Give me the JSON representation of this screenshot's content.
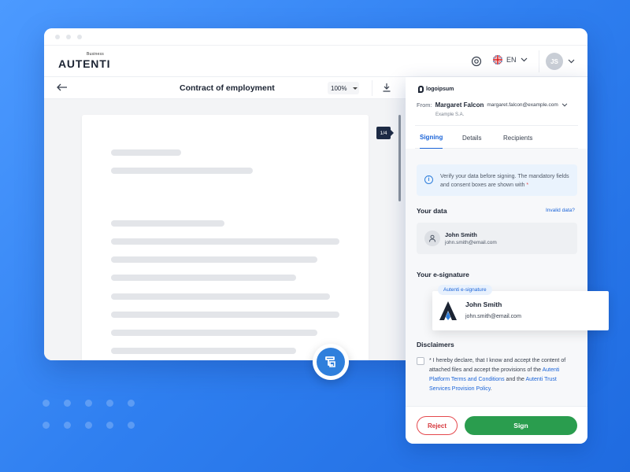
{
  "app": {
    "logo_main": "AUTENTI",
    "logo_sub": "Business",
    "language": "EN",
    "user_initials": "JS"
  },
  "doc_toolbar": {
    "title": "Contract of employment",
    "zoom": "100%"
  },
  "viewer": {
    "page_indicator": "1/4"
  },
  "panel": {
    "logo_text": "logoipsum",
    "from_label": "From:",
    "sender_name": "Margaret Falcon",
    "sender_email": "margaret.falcon@example.com",
    "sender_company": "Example S.A.",
    "tabs": [
      {
        "label": "Signing"
      },
      {
        "label": "Details"
      },
      {
        "label": "Recipients"
      }
    ],
    "info_text": "Verify your data before signing. The mandatory fields and consent boxes are shown with",
    "required_mark": "*",
    "your_data": {
      "title": "Your data",
      "invalid_link": "Invalid data?",
      "name": "John Smith",
      "email": "john.smith@email.com"
    },
    "esignature": {
      "title": "Your e-signature",
      "chip": "Autenti e-signature",
      "name": "John Smith",
      "email": "john.smith@email.com"
    },
    "disclaimers": {
      "title": "Disclaimers",
      "prefix": "* I hereby declare, that I know and accept the content of attached files and accept the provisions of the",
      "link1": "Autenti Platform Terms and Conditions",
      "middle": "and the",
      "link2": "Autenti Trust Services Provision Policy",
      "suffix": "."
    },
    "buttons": {
      "reject": "Reject",
      "sign": "Sign"
    }
  },
  "colors": {
    "accent": "#1b64d8",
    "sign_button": "#2a9d4e",
    "reject": "#e5484d",
    "background": "#2f7ff0"
  }
}
